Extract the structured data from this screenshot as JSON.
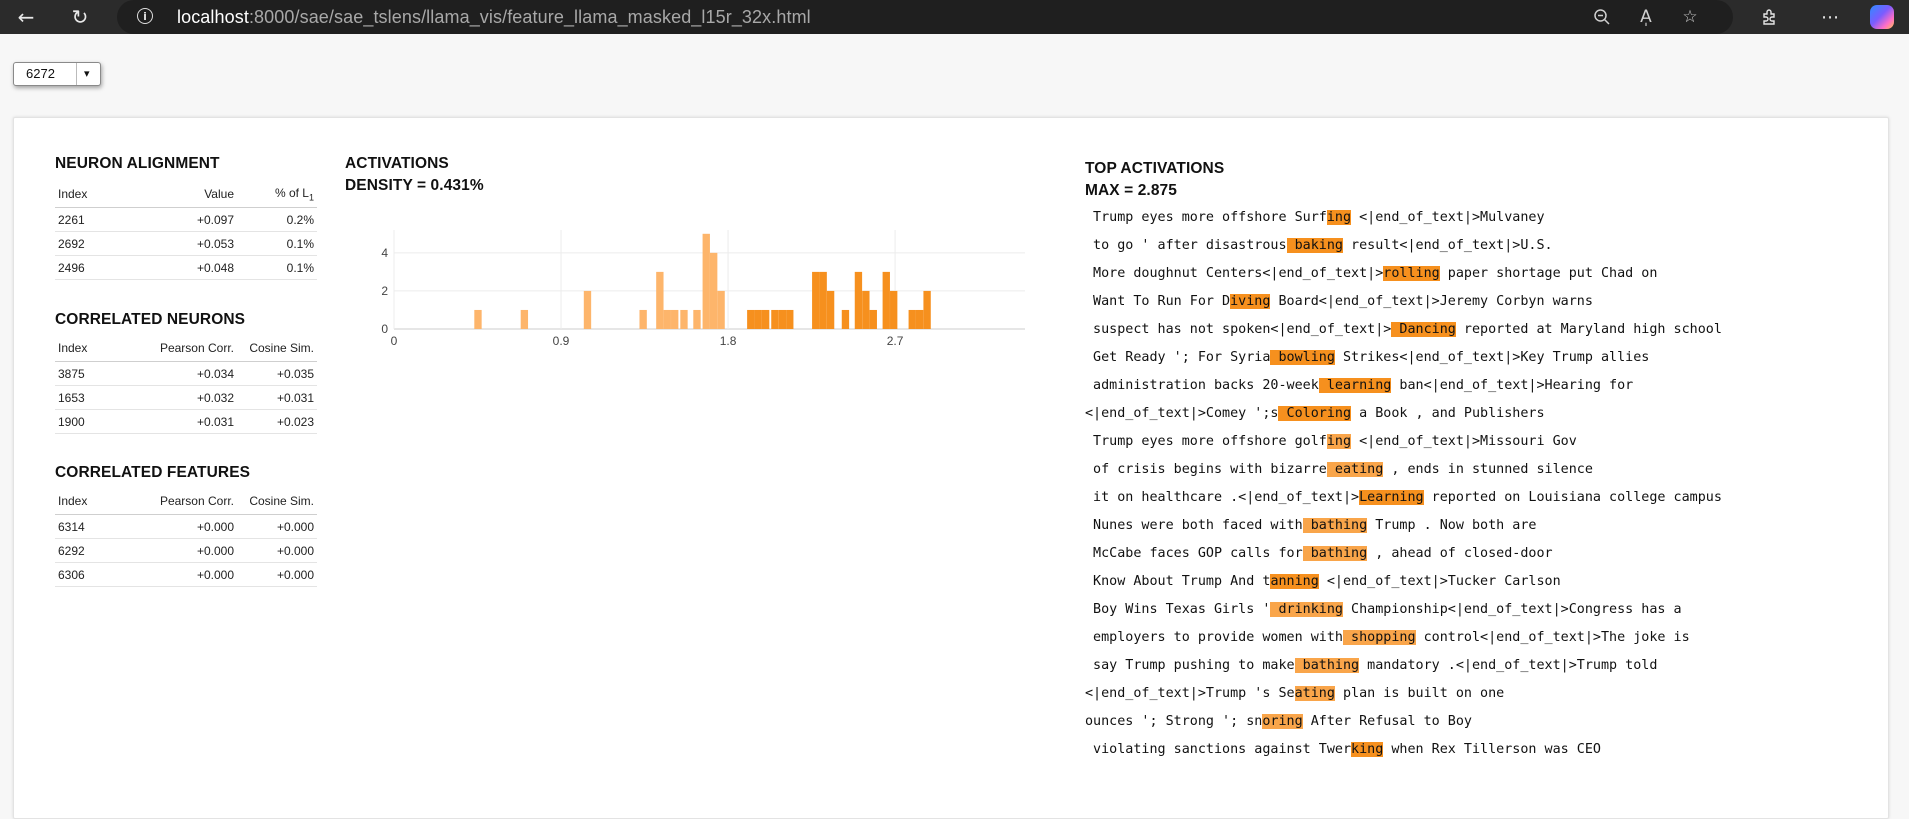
{
  "browser": {
    "url_host": "localhost",
    "url_path": ":8000/sae/sae_tslens/llama_vis/feature_llama_masked_l15r_32x.html",
    "icons": [
      "back-arrow-icon",
      "refresh-icon",
      "info-icon",
      "zoom-out-icon",
      "read-aloud-icon",
      "favorite-star-icon",
      "extensions-icon",
      "more-icon",
      "copilot-icon"
    ]
  },
  "selector": {
    "value": "6272",
    "caret": "▾"
  },
  "neuron_alignment": {
    "title": "NEURON ALIGNMENT",
    "headers": [
      "Index",
      "Value",
      "% of L"
    ],
    "header_sub": "1",
    "rows": [
      [
        "2261",
        "+0.097",
        "0.2%"
      ],
      [
        "2692",
        "+0.053",
        "0.1%"
      ],
      [
        "2496",
        "+0.048",
        "0.1%"
      ]
    ]
  },
  "correlated_neurons": {
    "title": "CORRELATED NEURONS",
    "headers": [
      "Index",
      "Pearson Corr.",
      "Cosine Sim."
    ],
    "rows": [
      [
        "3875",
        "+0.034",
        "+0.035"
      ],
      [
        "1653",
        "+0.032",
        "+0.031"
      ],
      [
        "1900",
        "+0.031",
        "+0.023"
      ]
    ]
  },
  "correlated_features": {
    "title": "CORRELATED FEATURES",
    "headers": [
      "Index",
      "Pearson Corr.",
      "Cosine Sim."
    ],
    "rows": [
      [
        "6314",
        "+0.000",
        "+0.000"
      ],
      [
        "6292",
        "+0.000",
        "+0.000"
      ],
      [
        "6306",
        "+0.000",
        "+0.000"
      ]
    ]
  },
  "activations": {
    "title": "ACTIVATIONS",
    "density_label": "DENSITY = 0.431%"
  },
  "chart_data": {
    "type": "bar",
    "x_ticks": [
      0,
      0.9,
      1.8,
      2.7
    ],
    "y_ticks": [
      0,
      2,
      4
    ],
    "xlim": [
      0,
      3.4
    ],
    "ylim": [
      0,
      5.2
    ],
    "bin_width": 0.045,
    "light_color": "#fdb56b",
    "dark_color": "#f6901e",
    "bins": [
      {
        "x": 0.43,
        "count": 1,
        "shade": "light"
      },
      {
        "x": 0.68,
        "count": 1,
        "shade": "light"
      },
      {
        "x": 1.02,
        "count": 2,
        "shade": "light"
      },
      {
        "x": 1.32,
        "count": 1,
        "shade": "light"
      },
      {
        "x": 1.41,
        "count": 3,
        "shade": "light"
      },
      {
        "x": 1.45,
        "count": 1,
        "shade": "light"
      },
      {
        "x": 1.49,
        "count": 1,
        "shade": "light"
      },
      {
        "x": 1.54,
        "count": 1,
        "shade": "light"
      },
      {
        "x": 1.61,
        "count": 1,
        "shade": "light"
      },
      {
        "x": 1.66,
        "count": 5,
        "shade": "light"
      },
      {
        "x": 1.7,
        "count": 4,
        "shade": "light"
      },
      {
        "x": 1.74,
        "count": 2,
        "shade": "light"
      },
      {
        "x": 1.9,
        "count": 1,
        "shade": "dark"
      },
      {
        "x": 1.94,
        "count": 1,
        "shade": "dark"
      },
      {
        "x": 1.98,
        "count": 1,
        "shade": "dark"
      },
      {
        "x": 2.03,
        "count": 1,
        "shade": "dark"
      },
      {
        "x": 2.07,
        "count": 1,
        "shade": "dark"
      },
      {
        "x": 2.11,
        "count": 1,
        "shade": "dark"
      },
      {
        "x": 2.25,
        "count": 3,
        "shade": "dark"
      },
      {
        "x": 2.29,
        "count": 3,
        "shade": "dark"
      },
      {
        "x": 2.33,
        "count": 2,
        "shade": "dark"
      },
      {
        "x": 2.41,
        "count": 1,
        "shade": "dark"
      },
      {
        "x": 2.48,
        "count": 3,
        "shade": "dark"
      },
      {
        "x": 2.52,
        "count": 2,
        "shade": "dark"
      },
      {
        "x": 2.56,
        "count": 1,
        "shade": "dark"
      },
      {
        "x": 2.63,
        "count": 3,
        "shade": "dark"
      },
      {
        "x": 2.67,
        "count": 2,
        "shade": "dark"
      },
      {
        "x": 2.77,
        "count": 1,
        "shade": "dark"
      },
      {
        "x": 2.81,
        "count": 1,
        "shade": "dark"
      },
      {
        "x": 2.85,
        "count": 2,
        "shade": "dark"
      }
    ]
  },
  "top_activations": {
    "title": "TOP ACTIVATIONS",
    "max_label": "MAX = 2.875",
    "rows": [
      [
        [
          " Trump eyes more offshore Surf",
          0
        ],
        [
          "ing",
          2
        ],
        [
          " <|end_of_text|>Mulvaney",
          0
        ]
      ],
      [
        [
          " to go ' after disastrous",
          0
        ],
        [
          " baking",
          2
        ],
        [
          " result<|end_of_text|>U.S.",
          0
        ]
      ],
      [
        [
          " More doughnut Centers<|end_of_text|>",
          0
        ],
        [
          "rolling",
          2
        ],
        [
          " paper shortage put Chad on",
          0
        ]
      ],
      [
        [
          " Want To Run For D",
          0
        ],
        [
          "iving",
          2
        ],
        [
          " Board<|end_of_text|>Jeremy Corbyn warns",
          0
        ]
      ],
      [
        [
          " suspect has not spoken<|end_of_text|>",
          0
        ],
        [
          " Dancing",
          2
        ],
        [
          " reported at Maryland high school",
          0
        ]
      ],
      [
        [
          " Get Ready '; For Syria",
          0
        ],
        [
          " bowling",
          2
        ],
        [
          " Strikes<|end_of_text|>Key Trump allies",
          0
        ]
      ],
      [
        [
          " administration backs 20-week",
          0
        ],
        [
          " learning",
          2
        ],
        [
          " ban<|end_of_text|>Hearing for",
          0
        ]
      ],
      [
        [
          "<|end_of_text|>Comey ';s",
          0
        ],
        [
          " Coloring",
          2
        ],
        [
          " a Book , and Publishers",
          0
        ]
      ],
      [
        [
          " Trump eyes more offshore golf",
          0
        ],
        [
          "ing",
          1
        ],
        [
          " <|end_of_text|>Missouri Gov",
          0
        ]
      ],
      [
        [
          " of crisis begins with bizarre",
          0
        ],
        [
          " eating",
          1
        ],
        [
          " , ends in stunned silence",
          0
        ]
      ],
      [
        [
          " it on healthcare .<|end_of_text|>",
          0
        ],
        [
          "Learning",
          2
        ],
        [
          " reported on Louisiana college campus",
          0
        ]
      ],
      [
        [
          " Nunes were both faced with",
          0
        ],
        [
          " bathing",
          1
        ],
        [
          " Trump . Now both are",
          0
        ]
      ],
      [
        [
          " McCabe faces GOP calls for",
          0
        ],
        [
          " bathing",
          1
        ],
        [
          " , ahead of closed-door",
          0
        ]
      ],
      [
        [
          " Know About Trump And t",
          0
        ],
        [
          "anning",
          2
        ],
        [
          " <|end_of_text|>Tucker Carlson",
          0
        ]
      ],
      [
        [
          " Boy Wins Texas Girls '",
          0
        ],
        [
          " drinking",
          1
        ],
        [
          " Championship<|end_of_text|>Congress has a",
          0
        ]
      ],
      [
        [
          " employers to provide women with",
          0
        ],
        [
          " shopping",
          1
        ],
        [
          " control<|end_of_text|>The joke is",
          0
        ]
      ],
      [
        [
          " say Trump pushing to make",
          0
        ],
        [
          " bathing",
          1
        ],
        [
          " mandatory .<|end_of_text|>Trump told",
          0
        ]
      ],
      [
        [
          "<|end_of_text|>Trump 's Se",
          0
        ],
        [
          "ating",
          1
        ],
        [
          " plan is built on one",
          0
        ]
      ],
      [
        [
          "ounces '; Strong '; sn",
          0
        ],
        [
          "oring",
          1
        ],
        [
          " After Refusal to Boy",
          0
        ]
      ],
      [
        [
          " violating sanctions against Twer",
          0
        ],
        [
          "king",
          2
        ],
        [
          " when Rex Tillerson was CEO",
          0
        ]
      ]
    ]
  }
}
